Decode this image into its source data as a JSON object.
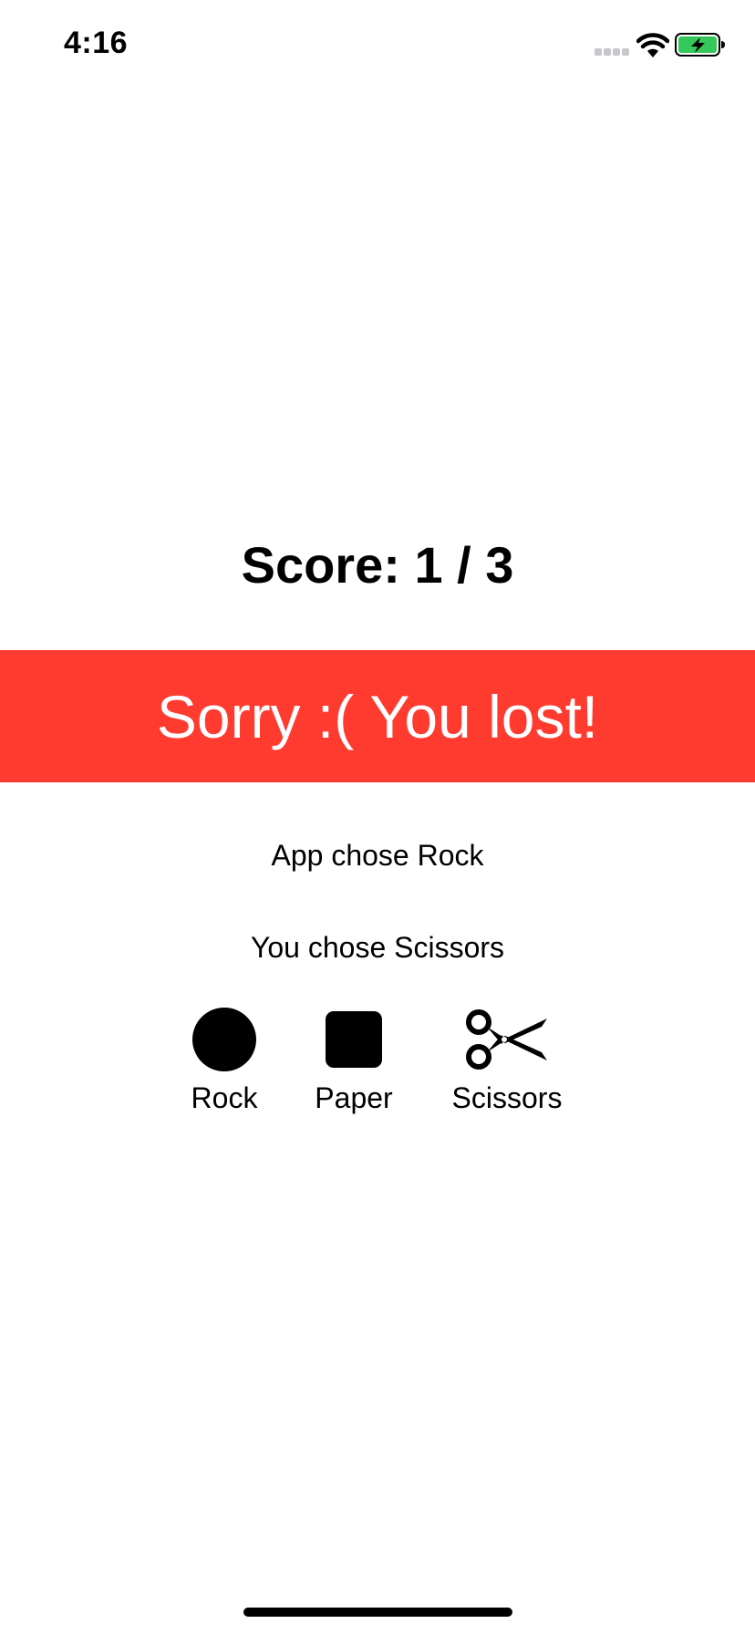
{
  "status_bar": {
    "time": "4:16",
    "icons": [
      "cellular-signal-icon",
      "wifi-icon",
      "battery-charging-icon"
    ],
    "battery_color": "#34c759"
  },
  "score": {
    "text": "Score: 1 / 3"
  },
  "result": {
    "text": "Sorry :( You lost!",
    "color": "#ff3b30"
  },
  "choices": {
    "app_choice": "App chose Rock",
    "user_choice": "You chose Scissors"
  },
  "buttons": [
    {
      "label": "Rock",
      "icon": "rock-icon"
    },
    {
      "label": "Paper",
      "icon": "paper-icon"
    },
    {
      "label": "Scissors",
      "icon": "scissors-icon"
    }
  ]
}
